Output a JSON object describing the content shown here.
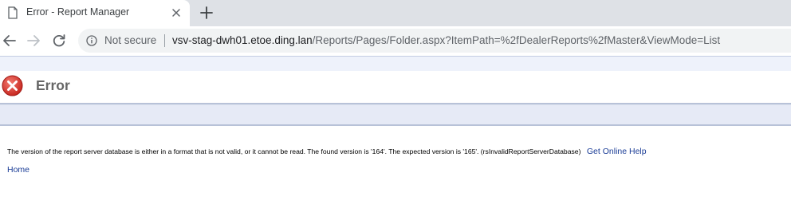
{
  "browser": {
    "tab": {
      "title": "Error - Report Manager"
    },
    "toolbar": {
      "security_label": "Not secure",
      "url_host": "vsv-stag-dwh01.etoe.ding.lan",
      "url_path": "/Reports/Pages/Folder.aspx?ItemPath=%2fDealerReports%2fMaster&ViewMode=List"
    }
  },
  "page": {
    "title": "Error",
    "error_message": "The version of the report server database is either in a format that is not valid, or it cannot be read. The found version is '164'. The expected version is '165'. (rsInvalidReportServerDatabase)",
    "help_link": "Get Online Help",
    "home_link": "Home"
  },
  "icons": {
    "tab": "page-icon",
    "close": "close-icon",
    "new_tab": "plus-icon",
    "back": "back-arrow-icon",
    "forward": "forward-arrow-icon",
    "reload": "reload-icon",
    "info": "info-icon",
    "error": "error-x-icon"
  },
  "colors": {
    "link": "#1a3c96",
    "error_icon": "#d9362f",
    "band": "#e6eaf6",
    "tabstrip": "#dee1e6"
  }
}
